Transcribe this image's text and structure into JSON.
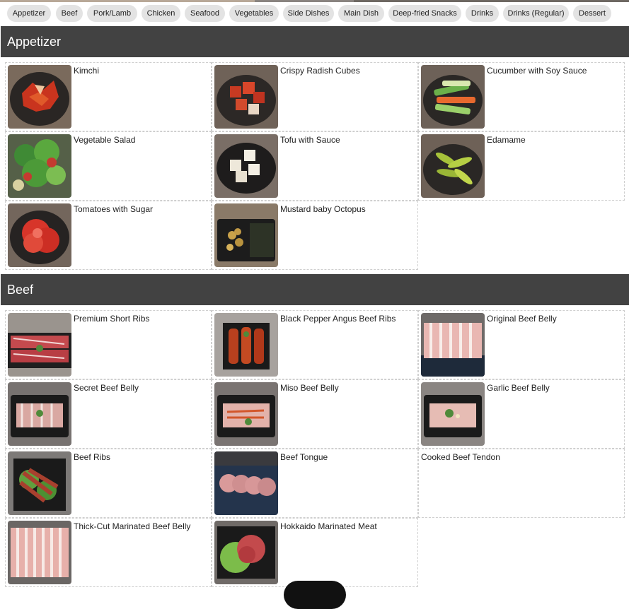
{
  "categories": [
    "Appetizer",
    "Beef",
    "Pork/Lamb",
    "Chicken",
    "Seafood",
    "Vegetables",
    "Side Dishes",
    "Main Dish",
    "Deep-fried Snacks",
    "Drinks",
    "Drinks (Regular)",
    "Dessert"
  ],
  "sections": [
    {
      "title": "Appetizer",
      "items": [
        {
          "name": "Kimchi",
          "image": "kimchi-photo"
        },
        {
          "name": "Crispy Radish Cubes",
          "image": "radish-cubes-photo"
        },
        {
          "name": "Cucumber with Soy Sauce",
          "image": "cucumber-photo"
        },
        {
          "name": "Vegetable Salad",
          "image": "salad-photo"
        },
        {
          "name": "Tofu with Sauce",
          "image": "tofu-photo"
        },
        {
          "name": "Edamame",
          "image": "edamame-photo"
        },
        {
          "name": "Tomatoes with Sugar",
          "image": "tomato-photo"
        },
        {
          "name": "Mustard baby Octopus",
          "image": "octopus-photo"
        }
      ]
    },
    {
      "title": "Beef",
      "items": [
        {
          "name": "Premium Short Ribs",
          "image": "short-ribs-photo"
        },
        {
          "name": "Black Pepper Angus Beef Ribs",
          "image": "pepper-ribs-photo"
        },
        {
          "name": "Original Beef Belly",
          "image": "beef-belly-photo"
        },
        {
          "name": "Secret Beef Belly",
          "image": "secret-belly-photo"
        },
        {
          "name": "Miso Beef Belly",
          "image": "miso-belly-photo"
        },
        {
          "name": "Garlic Beef Belly",
          "image": "garlic-belly-photo"
        },
        {
          "name": "Beef Ribs",
          "image": "beef-ribs-photo"
        },
        {
          "name": "Beef Tongue",
          "image": "beef-tongue-photo"
        },
        {
          "name": "Cooked Beef Tendon",
          "image": ""
        },
        {
          "name": "Thick-Cut Marinated Beef Belly",
          "image": "thick-belly-photo"
        },
        {
          "name": "Hokkaido Marinated Meat",
          "image": "hokkaido-meat-photo"
        }
      ]
    }
  ]
}
